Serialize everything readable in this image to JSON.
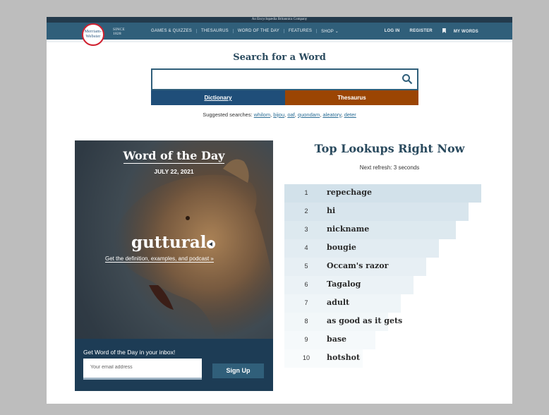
{
  "header": {
    "tagline": "An Encyclopædia Britannica Company",
    "logo_line1": "Merriam-",
    "logo_line2": "Webster",
    "since_label": "SINCE",
    "since_year": "1828",
    "nav": [
      "GAMES & QUIZZES",
      "THESAURUS",
      "WORD OF THE DAY",
      "FEATURES",
      "SHOP"
    ],
    "login": "LOG IN",
    "register": "REGISTER",
    "my_words": "MY WORDS"
  },
  "search": {
    "title": "Search for a Word",
    "value": "",
    "tab_dictionary": "Dictionary",
    "tab_thesaurus": "Thesaurus",
    "suggested_label": "Suggested searches:",
    "suggestions": [
      "whilom",
      "bijou",
      "oaf",
      "quondam",
      "aleatory",
      "deter"
    ]
  },
  "wotd": {
    "title": "Word of the Day",
    "date": "JULY 22, 2021",
    "word": "guttural",
    "link": "Get the definition, examples, and podcast »",
    "inbox_label": "Get Word of the Day in your inbox!",
    "email_placeholder": "Your email address",
    "signup": "Sign Up"
  },
  "lookups": {
    "title": "Top Lookups Right Now",
    "refresh": "Next refresh: 3 seconds",
    "items": [
      {
        "rank": "1",
        "term": "repechage"
      },
      {
        "rank": "2",
        "term": "hi"
      },
      {
        "rank": "3",
        "term": "nickname"
      },
      {
        "rank": "4",
        "term": "bougie"
      },
      {
        "rank": "5",
        "term": "Occam's razor"
      },
      {
        "rank": "6",
        "term": "Tagalog"
      },
      {
        "rank": "7",
        "term": "adult"
      },
      {
        "rank": "8",
        "term": "as good as it gets"
      },
      {
        "rank": "9",
        "term": "base"
      },
      {
        "rank": "10",
        "term": "hotshot"
      }
    ]
  },
  "colors": {
    "nav_bar": "#305f7a",
    "dictionary_tab": "#1f4e79",
    "thesaurus_tab": "#9b4503",
    "link": "#2a6d95"
  }
}
